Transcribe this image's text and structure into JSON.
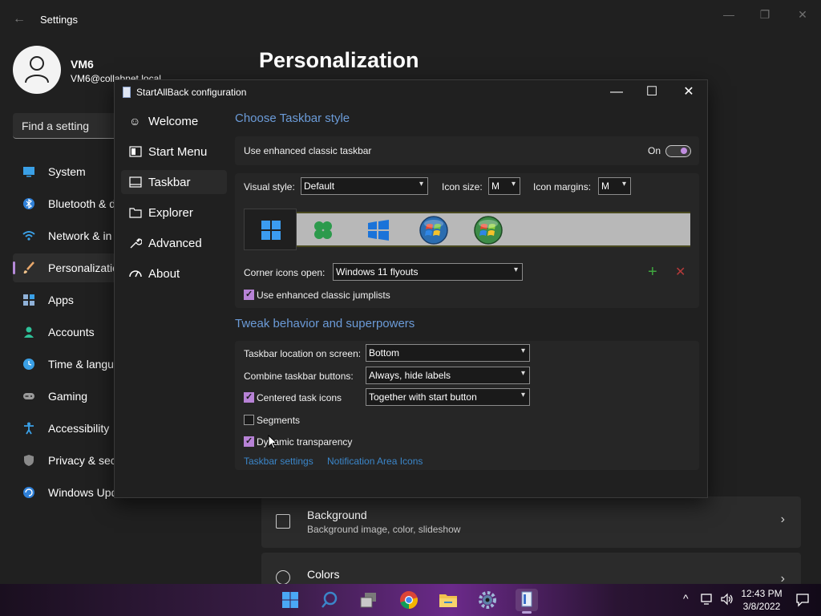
{
  "settings": {
    "title": "Settings",
    "user": {
      "name": "VM6",
      "email": "VM6@collabnet.local"
    },
    "search_placeholder": "Find a setting",
    "nav": [
      {
        "label": "System",
        "icon": "monitor-icon"
      },
      {
        "label": "Bluetooth & d",
        "icon": "bluetooth-icon"
      },
      {
        "label": "Network & in",
        "icon": "wifi-icon"
      },
      {
        "label": "Personalizatio",
        "icon": "brush-icon"
      },
      {
        "label": "Apps",
        "icon": "apps-icon"
      },
      {
        "label": "Accounts",
        "icon": "person-icon"
      },
      {
        "label": "Time & langu",
        "icon": "clock-icon"
      },
      {
        "label": "Gaming",
        "icon": "gamepad-icon"
      },
      {
        "label": "Accessibility",
        "icon": "accessibility-icon"
      },
      {
        "label": "Privacy & sec",
        "icon": "shield-icon"
      },
      {
        "label": "Windows Upd",
        "icon": "update-icon"
      }
    ],
    "heading": "Personalization",
    "cards": [
      {
        "title": "Background",
        "subtitle": "Background image, color, slideshow"
      },
      {
        "title": "Colors",
        "subtitle": ""
      }
    ]
  },
  "dialog": {
    "title": "StartAllBack configuration",
    "sidebar": [
      {
        "label": "Welcome",
        "icon": "smile-icon"
      },
      {
        "label": "Start Menu",
        "icon": "start-menu-icon"
      },
      {
        "label": "Taskbar",
        "icon": "taskbar-icon"
      },
      {
        "label": "Explorer",
        "icon": "folder-icon"
      },
      {
        "label": "Advanced",
        "icon": "wrench-icon"
      },
      {
        "label": "About",
        "icon": "speedometer-icon"
      }
    ],
    "section1": {
      "title": "Choose Taskbar style",
      "enhanced_label": "Use enhanced classic taskbar",
      "toggle_label": "On",
      "visual_style_label": "Visual style:",
      "visual_style_value": "Default",
      "icon_size_label": "Icon size:",
      "icon_size_value": "M",
      "icon_margins_label": "Icon margins:",
      "icon_margins_value": "M",
      "corner_label": "Corner icons open:",
      "corner_value": "Windows 11 flyouts",
      "jumplists_label": "Use enhanced classic jumplists"
    },
    "section2": {
      "title": "Tweak behavior and superpowers",
      "location_label": "Taskbar location on screen:",
      "location_value": "Bottom",
      "combine_label": "Combine taskbar buttons:",
      "combine_value": "Always, hide labels",
      "centered_label": "Centered task icons",
      "centered_value": "Together with start button",
      "segments_label": "Segments",
      "transparency_label": "Dynamic transparency",
      "link_taskbar": "Taskbar settings",
      "link_notification": "Notification Area Icons"
    }
  },
  "taskbar": {
    "time": "12:43 PM",
    "date": "3/8/2022"
  },
  "colors": {
    "accent": "#b782d6",
    "link": "#3b86c9",
    "section_title": "#6b9bd8"
  }
}
